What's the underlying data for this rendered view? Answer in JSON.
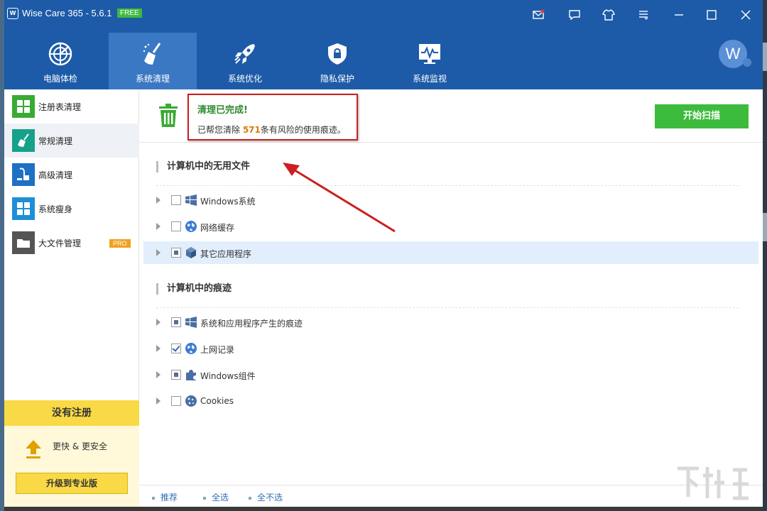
{
  "window": {
    "title": "Wise Care 365 - 5.6.1",
    "badge": "FREE",
    "controls": [
      "mail-icon",
      "feedback-icon",
      "skin-icon",
      "menu-icon",
      "minimize-icon",
      "maximize-icon",
      "close-icon"
    ]
  },
  "nav": {
    "items": [
      {
        "label": "电脑体检",
        "icon": "radar-icon"
      },
      {
        "label": "系统清理",
        "icon": "broom-icon",
        "active": true
      },
      {
        "label": "系统优化",
        "icon": "rocket-icon"
      },
      {
        "label": "隐私保护",
        "icon": "shield-lock-icon"
      },
      {
        "label": "系统监视",
        "icon": "monitor-pulse-icon"
      }
    ],
    "avatar_letter": "W"
  },
  "sidebar": {
    "items": [
      {
        "label": "注册表清理",
        "icon": "grid-icon",
        "color": "#3aaa35"
      },
      {
        "label": "常规清理",
        "icon": "broom-icon",
        "color": "#17a08a",
        "active": true
      },
      {
        "label": "高级清理",
        "icon": "vacuum-icon",
        "color": "#1e6fc6"
      },
      {
        "label": "系统瘦身",
        "icon": "windows-icon",
        "color": "#1e8fd6"
      },
      {
        "label": "大文件管理",
        "icon": "folder-icon",
        "color": "#555555",
        "badge": "PRO"
      }
    ],
    "promo": {
      "heading": "没有注册",
      "text": "更快 & 更安全",
      "button": "升级到专业版"
    }
  },
  "status": {
    "title": "清理已完成!",
    "desc_prefix": "已帮您清除 ",
    "count": "571",
    "desc_suffix": "条有风险的使用痕迹。",
    "scan_button": "开始扫描"
  },
  "sections": [
    {
      "title": "计算机中的无用文件",
      "rows": [
        {
          "label": "Windows系统",
          "icon": "windows-flag-icon",
          "state": "unchecked"
        },
        {
          "label": "网络缓存",
          "icon": "globe-icon",
          "state": "unchecked"
        },
        {
          "label": "其它应用程序",
          "icon": "cube-icon",
          "state": "partial",
          "highlight": true
        }
      ]
    },
    {
      "title": "计算机中的痕迹",
      "rows": [
        {
          "label": "系统和应用程序产生的痕迹",
          "icon": "windows-flag-icon",
          "state": "partial"
        },
        {
          "label": "上网记录",
          "icon": "globe-icon",
          "state": "checked"
        },
        {
          "label": "Windows组件",
          "icon": "puzzle-icon",
          "state": "partial"
        },
        {
          "label": "Cookies",
          "icon": "cookie-icon",
          "state": "unchecked"
        }
      ]
    }
  ],
  "footer": {
    "links": [
      "推荐",
      "全选",
      "全不选"
    ]
  },
  "colors": {
    "brand_blue": "#1d5ba8",
    "active_tab": "#3b78c3",
    "success_green": "#3dbb3d",
    "annotation_red": "#cc1f1f",
    "promo_yellow": "#f9d945"
  }
}
